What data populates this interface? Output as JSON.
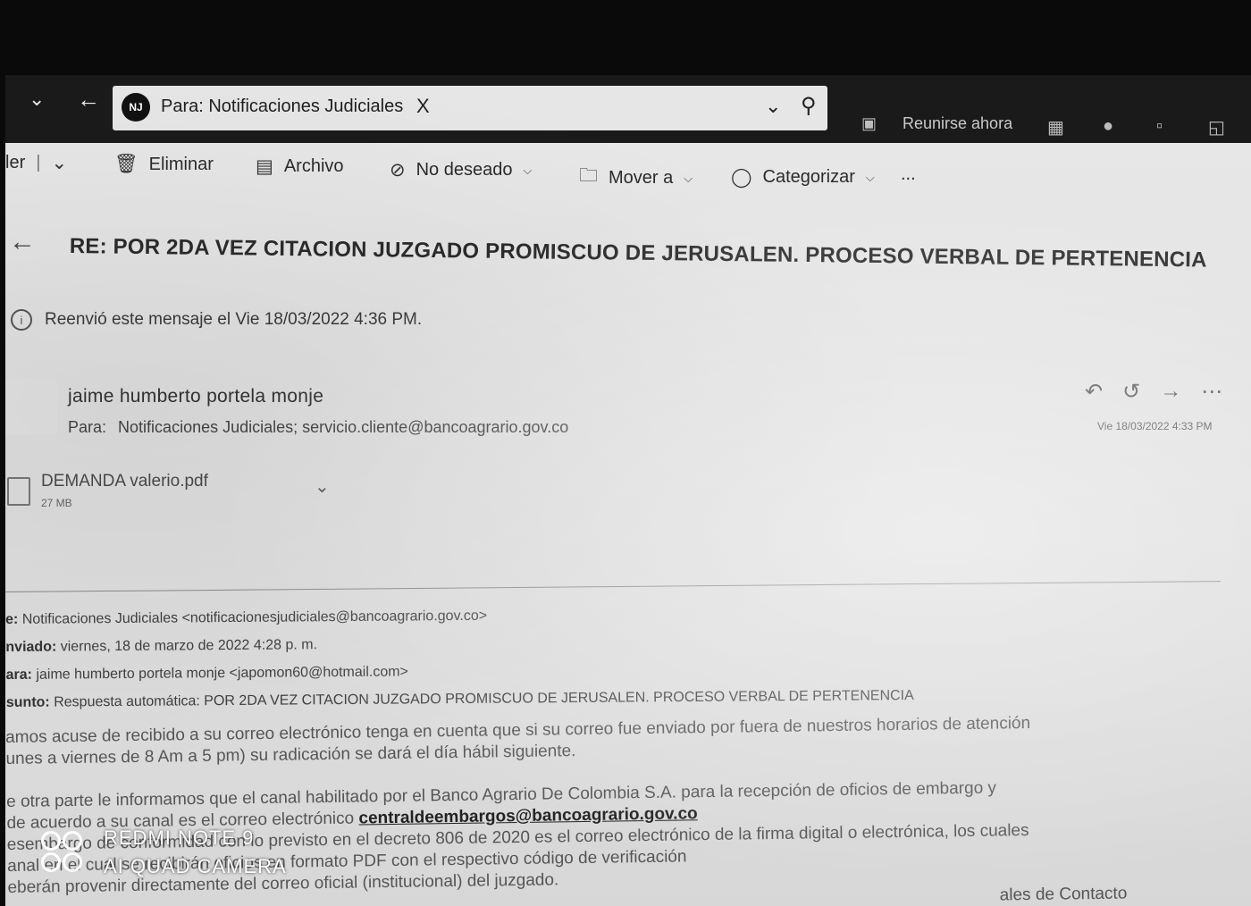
{
  "topbar": {
    "recipient_chip": {
      "avatar_initials": "NJ",
      "label": "Para: Notificaciones Judiciales",
      "close_glyph": "X"
    },
    "meet_now_label": "Reunirse ahora"
  },
  "toolbar": {
    "truncated_label": "ler",
    "delete_label": "Eliminar",
    "archive_label": "Archivo",
    "junk_label": "No deseado",
    "move_label": "Mover a",
    "categorize_label": "Categorizar",
    "more_label": "..."
  },
  "message": {
    "subject": "RE: POR 2DA VEZ CITACION JUZGADO PROMISCUO DE JERUSALEN. PROCESO VERBAL DE PERTENENCIA",
    "forward_info": "Reenvió este mensaje el Vie 18/03/2022 4:36 PM.",
    "sender_name": "jaime humberto portela monje",
    "recipients_prefix": "Para:",
    "recipients": "Notificaciones Judiciales;  servicio.cliente@bancoagrario.gov.co",
    "date": "Vie 18/03/2022 4:33 PM",
    "attachment": {
      "name": "DEMANDA valerio.pdf",
      "size": "27 MB"
    }
  },
  "quoted_header": {
    "from_label": "e:",
    "from_value": "Notificaciones Judiciales <notificacionesjudiciales@bancoagrario.gov.co>",
    "sent_label": "nviado:",
    "sent_value": "viernes, 18 de marzo de 2022 4:28 p. m.",
    "to_label": "ara:",
    "to_value": "jaime humberto portela monje <japomon60@hotmail.com>",
    "subject_label": "sunto:",
    "subject_value": "Respuesta automática: POR 2DA VEZ CITACION JUZGADO PROMISCUO DE JERUSALEN. PROCESO VERBAL DE PERTENENCIA"
  },
  "body": {
    "p1_line1": "amos acuse de recibido a su correo electrónico tenga en cuenta que si su correo fue enviado por fuera de nuestros horarios de atención",
    "p1_line2": "unes a viernes de 8 Am a 5 pm) su radicación se dará el día hábil siguiente.",
    "p2_line1_text": "e otra parte le informamos que el canal habilitado por el Banco Agrario De Colombia  S.A. para la recepción de oficios de embargo y",
    "p2_line1b_text": "de acuerdo a su canal es el correo electrónico",
    "p2_link": "centraldeembargos@bancoagrario.gov.co",
    "p2_line2": "esembargo de conformidad con lo previsto en el decreto 806 de 2020 es el correo electrónico de la firma digital o electrónica, los cuales",
    "p2_line3": "anal en el cual se recibirán oficios en formato PDF con el respectivo código de verificación",
    "p2_line4": "eberán provenir directamente del correo oficial (institucional) del juzgado.",
    "p3_partial": "ales de Contacto"
  },
  "watermark": {
    "line1": "REDMI NOTE 9",
    "line2": "AI QUAD CAMERA"
  }
}
